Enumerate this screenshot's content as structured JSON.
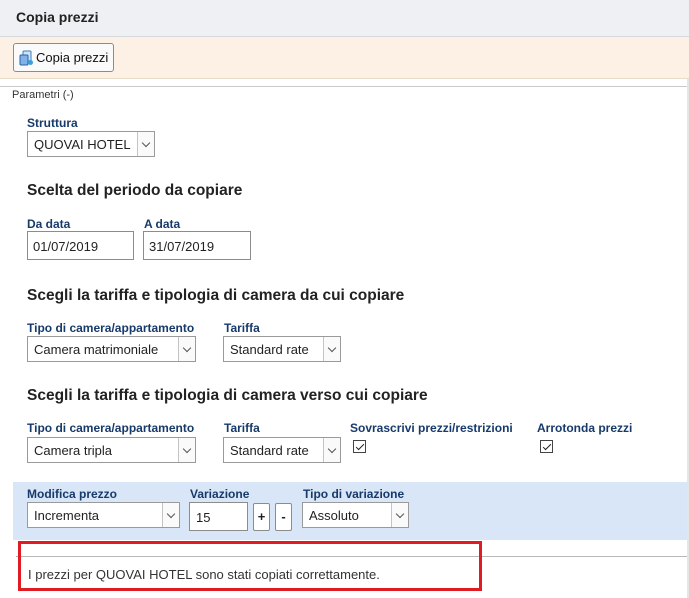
{
  "window": {
    "title": "Copia prezzi"
  },
  "toolbar": {
    "copy_button_label": "Copia prezzi",
    "copy_button_icon": "copy-icon"
  },
  "params": {
    "legend": "Parametri (-)"
  },
  "structure": {
    "label": "Struttura",
    "value": "QUOVAI HOTEL"
  },
  "period": {
    "heading": "Scelta del periodo da copiare",
    "from_label": "Da data",
    "from_value": "01/07/2019",
    "to_label": "A data",
    "to_value": "31/07/2019"
  },
  "source": {
    "heading": "Scegli la tariffa e tipologia di camera da cui copiare",
    "room_label": "Tipo di camera/appartamento",
    "room_value": "Camera matrimoniale",
    "rate_label": "Tariffa",
    "rate_value": "Standard rate"
  },
  "target": {
    "heading": "Scegli la tariffa e tipologia di camera verso cui copiare",
    "room_label": "Tipo di camera/appartamento",
    "room_value": "Camera tripla",
    "rate_label": "Tariffa",
    "rate_value": "Standard rate",
    "overwrite_label": "Sovrascrivi prezzi/restrizioni",
    "overwrite_checked": true,
    "round_label": "Arrotonda prezzi",
    "round_checked": true
  },
  "variation": {
    "modify_label": "Modifica prezzo",
    "modify_value": "Incrementa",
    "amount_label": "Variazione",
    "amount_value": "15",
    "plus_label": "+",
    "minus_label": "-",
    "type_label": "Tipo di variazione",
    "type_value": "Assoluto"
  },
  "result": {
    "message": "I prezzi per QUOVAI HOTEL sono stati copiati correttamente."
  },
  "colors": {
    "label_blue": "#173a6b",
    "highlight_red": "#e01b24",
    "band_blue": "#d8e6f7",
    "toolbar_bg": "#fcf1e4"
  }
}
